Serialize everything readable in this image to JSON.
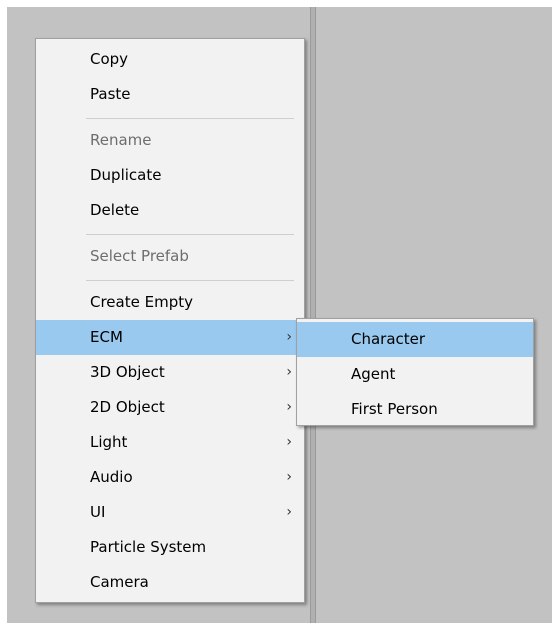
{
  "context_menu": {
    "items": [
      {
        "label": "Copy"
      },
      {
        "label": "Paste"
      },
      {
        "label": "Rename"
      },
      {
        "label": "Duplicate"
      },
      {
        "label": "Delete"
      },
      {
        "label": "Select Prefab"
      },
      {
        "label": "Create Empty"
      },
      {
        "label": "ECM"
      },
      {
        "label": "3D Object"
      },
      {
        "label": "2D Object"
      },
      {
        "label": "Light"
      },
      {
        "label": "Audio"
      },
      {
        "label": "UI"
      },
      {
        "label": "Particle System"
      },
      {
        "label": "Camera"
      }
    ],
    "submenu_arrow": "›",
    "highlighted_item": "ECM"
  },
  "ecm_submenu": {
    "items": [
      {
        "label": "Character"
      },
      {
        "label": "Agent"
      },
      {
        "label": "First Person"
      }
    ],
    "highlighted_item": "Character"
  },
  "colors": {
    "highlight": "#99c9ef",
    "menu_background": "#f2f2f2",
    "panel_background": "#c2c2c2",
    "disabled_text": "#6d6d6d"
  }
}
